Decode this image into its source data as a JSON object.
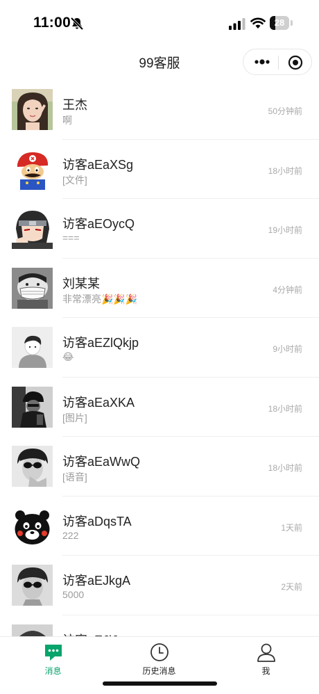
{
  "status_bar": {
    "time": "11:00",
    "battery": "28",
    "battery_level": 0.28
  },
  "nav": {
    "title": "99客服"
  },
  "chats": [
    {
      "name": "王杰",
      "message": "啊",
      "time": "50分钟前",
      "avatar": "avatar-girl-photo"
    },
    {
      "name": "访客aEaXSg",
      "message": "[文件]",
      "time": "18小时前",
      "avatar": "avatar-mario-cartoon"
    },
    {
      "name": "访客aEOycQ",
      "message": "===",
      "time": "19小时前",
      "avatar": "avatar-anime-ninja"
    },
    {
      "name": "刘某某",
      "message": "非常漂亮🎉🎉🎉",
      "time": "4分钟前",
      "avatar": "avatar-masked-cartoon"
    },
    {
      "name": "访客aEZlQkjp",
      "message": "😂",
      "time": "9小时前",
      "avatar": "avatar-default-person"
    },
    {
      "name": "访客aEaXKA",
      "message": "[图片]",
      "time": "18小时前",
      "avatar": "avatar-dark-photo"
    },
    {
      "name": "访客aEaWwQ",
      "message": "[语音]",
      "time": "18小时前",
      "avatar": "avatar-sunglasses-photo"
    },
    {
      "name": "访客aDqsTA",
      "message": "222",
      "time": "1天前",
      "avatar": "avatar-kumamon"
    },
    {
      "name": "访客aEJkgA",
      "message": "5000",
      "time": "2天前",
      "avatar": "avatar-sunglasses-photo-2"
    },
    {
      "name": "访客aEJlJq",
      "message": "",
      "time": "",
      "avatar": "avatar-partial-photo"
    }
  ],
  "tabs": [
    {
      "label": "消息",
      "icon": "chat-bubble-icon",
      "active": true
    },
    {
      "label": "历史消息",
      "icon": "clock-icon",
      "active": false
    },
    {
      "label": "我",
      "icon": "person-icon",
      "active": false
    }
  ],
  "colors": {
    "accent": "#07a46b",
    "text": "#222222",
    "muted": "#9b9b9b"
  }
}
